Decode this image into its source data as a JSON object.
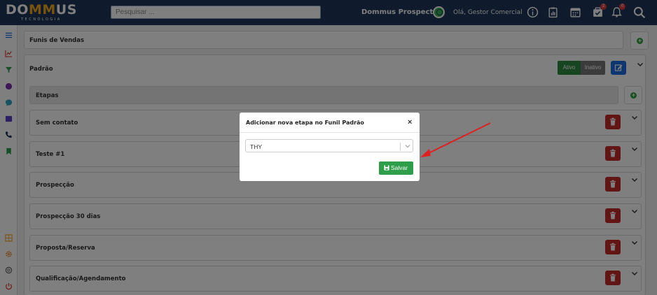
{
  "header": {
    "logo_main_prefix": "DO",
    "logo_main_mm": "MM",
    "logo_main_suffix": "US",
    "logo_sub": "TECNOLOGIA",
    "search_placeholder": "Pesquisar ...",
    "app_name": "Dommus Prospecta",
    "greeting": "Olá, Gestor Comercial",
    "icons": [
      "user-avatar-icon",
      "info-icon",
      "report-icon",
      "calendar-icon",
      "task-icon",
      "bell-icon",
      "search-icon"
    ],
    "badges": {
      "task": "2",
      "bell": "0"
    }
  },
  "sidebar": {
    "icons": [
      "menu-icon",
      "chart-icon",
      "funnel-icon",
      "circle-icon",
      "chat-icon",
      "calendar-icon",
      "phone-icon",
      "bookmark-icon",
      "grid-icon",
      "gear-icon",
      "support-icon",
      "power-icon"
    ]
  },
  "funnels": {
    "section_title": "Funis de Vendas",
    "funnel_name": "Padrão",
    "status_active": "Ativo",
    "status_inactive": "Inativo",
    "stages_title": "Etapas",
    "stages": [
      {
        "label": "Sem contato"
      },
      {
        "label": "Teste #1"
      },
      {
        "label": "Prospecção"
      },
      {
        "label": "Prospecção 30 dias"
      },
      {
        "label": "Proposta/Reserva"
      },
      {
        "label": "Qualificação/Agendamento"
      }
    ]
  },
  "modal": {
    "title": "Adicionar nova etapa no Funil Padrão",
    "close": "×",
    "select_value": "THY",
    "save_label": "Salvar"
  },
  "colors": {
    "header_bg": "#1e3658",
    "accent_orange": "#f0a81c",
    "success": "#2e9e4a",
    "danger": "#c52a2a",
    "primary": "#1d6fe0",
    "annotation_arrow": "#e02020"
  }
}
